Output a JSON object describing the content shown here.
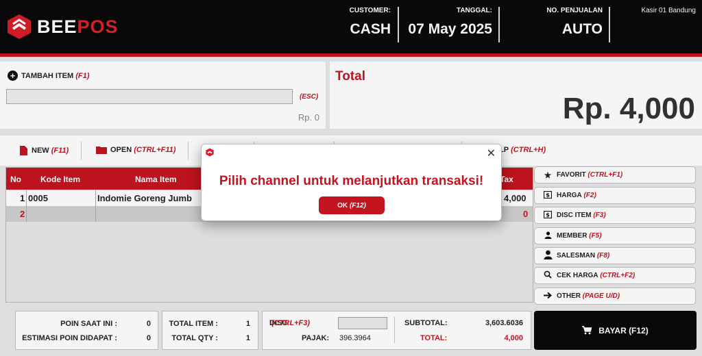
{
  "header": {
    "brand_a": "BEE",
    "brand_b": "POS",
    "customer_label": "CUSTOMER:",
    "customer_value": "CASH",
    "tanggal_label": "TANGGAL:",
    "tanggal_value": "07 May 2025",
    "no_penjualan_label": "NO. PENJUALAN",
    "no_penjualan_value": "AUTO",
    "kasir_label": "Kasir 01 Bandung"
  },
  "tambah": {
    "label": "TAMBAH ITEM",
    "shortcut": "(F1)",
    "input_value": "",
    "esc": "(ESC)",
    "price": "Rp. 0"
  },
  "total": {
    "label": "Total",
    "value": "Rp. 4,000"
  },
  "toolbar": {
    "new_label": "NEW",
    "new_shortcut": "(F11)",
    "open_label": "OPEN",
    "open_shortcut": "(CTRL+F11)",
    "help_label": "LP",
    "help_shortcut": "(CTRL+H)"
  },
  "table": {
    "headers": [
      "No",
      "Kode Item",
      "Nama Item",
      "Tax"
    ],
    "rows": [
      {
        "no": "1",
        "kode": "0005",
        "nama": "Indomie Goreng Jumb",
        "tax": "4,000"
      },
      {
        "no": "2",
        "kode": "",
        "nama": "",
        "tax": "0"
      }
    ]
  },
  "side": [
    {
      "label": "FAVORIT",
      "shortcut": "(CTRL+F1)",
      "icon": "star-icon"
    },
    {
      "label": "HARGA",
      "shortcut": "(F2)",
      "icon": "dollar-icon"
    },
    {
      "label": "DISC ITEM",
      "shortcut": "(F3)",
      "icon": "dollar-icon"
    },
    {
      "label": "MEMBER",
      "shortcut": "(F5)",
      "icon": "person-icon"
    },
    {
      "label": "SALESMAN",
      "shortcut": "(F8)",
      "icon": "person-icon"
    },
    {
      "label": "CEK HARGA",
      "shortcut": "(CTRL+F2)",
      "icon": "search-icon"
    },
    {
      "label": "OTHER",
      "shortcut": "(PAGE U/D)",
      "icon": "arrow-right-icon"
    }
  ],
  "bottom": {
    "poin_label": "POIN SAAT INI :",
    "poin_value": "0",
    "estimasi_label": "ESTIMASI POIN DIDAPAT :",
    "estimasi_value": "0",
    "total_item_label": "TOTAL ITEM :",
    "total_item_value": "1",
    "total_qty_label": "TOTAL QTY :",
    "total_qty_value": "1",
    "disc_label": "DISC",
    "disc_shortcut": "(CTRL+F3)",
    "disc_value": "",
    "pajak_label": "PAJAK:",
    "pajak_value": "396.3964",
    "subtotal_label": "SUBTOTAL:",
    "subtotal_value": "3,603.6036",
    "total_label": "TOTAL:",
    "total_value": "4,000",
    "bayar_label": "BAYAR (F12)"
  },
  "modal": {
    "message": "Pilih channel untuk melanjutkan transaksi!",
    "ok_label": "OK",
    "ok_shortcut": "(F12)"
  },
  "colors": {
    "accent": "#c41420",
    "header_bg": "#0a0a0a"
  }
}
